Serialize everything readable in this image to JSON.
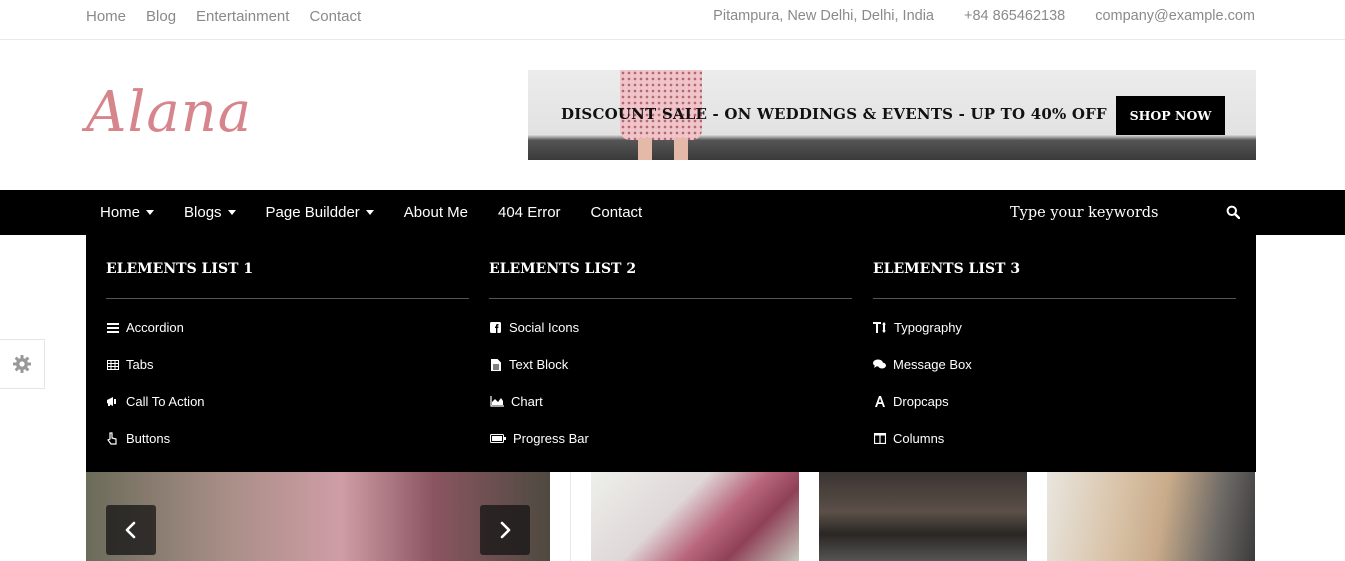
{
  "topbar": {
    "nav": [
      "Home",
      "Blog",
      "Entertainment",
      "Contact"
    ],
    "address": "Pitampura, New Delhi, Delhi, India",
    "phone": "+84 865462138",
    "email": "company@example.com"
  },
  "header": {
    "logo": "Alana",
    "banner": {
      "text": "DISCOUNT SALE - ON WEDDINGS & EVENTS - UP TO 40% OFF",
      "button": "SHOP NOW"
    }
  },
  "mainnav": {
    "items": [
      {
        "label": "Home",
        "has_dropdown": true
      },
      {
        "label": "Blogs",
        "has_dropdown": true
      },
      {
        "label": "Page Buildder",
        "has_dropdown": true
      },
      {
        "label": "About Me",
        "has_dropdown": false
      },
      {
        "label": "404 Error",
        "has_dropdown": false
      },
      {
        "label": "Contact",
        "has_dropdown": false
      }
    ],
    "search_placeholder": "Type your keywords"
  },
  "megamenu": {
    "columns": [
      {
        "title": "ELEMENTS LIST 1",
        "items": [
          {
            "label": "Accordion",
            "icon": "list-icon"
          },
          {
            "label": "Tabs",
            "icon": "table-icon"
          },
          {
            "label": "Call To Action",
            "icon": "bullhorn-icon"
          },
          {
            "label": "Buttons",
            "icon": "hand-pointer-icon"
          }
        ]
      },
      {
        "title": "ELEMENTS LIST 2",
        "items": [
          {
            "label": "Social Icons",
            "icon": "facebook-square-icon"
          },
          {
            "label": "Text Block",
            "icon": "file-text-icon"
          },
          {
            "label": "Chart",
            "icon": "area-chart-icon"
          },
          {
            "label": "Progress Bar",
            "icon": "battery-icon"
          }
        ]
      },
      {
        "title": "ELEMENTS LIST 3",
        "items": [
          {
            "label": "Typography",
            "icon": "text-height-icon"
          },
          {
            "label": "Message Box",
            "icon": "comments-icon"
          },
          {
            "label": "Dropcaps",
            "icon": "font-icon"
          },
          {
            "label": "Columns",
            "icon": "columns-icon"
          }
        ]
      }
    ]
  },
  "colors": {
    "accent": "#d7858c",
    "nav_bg": "#000000",
    "muted_text": "#8a8a8a"
  }
}
